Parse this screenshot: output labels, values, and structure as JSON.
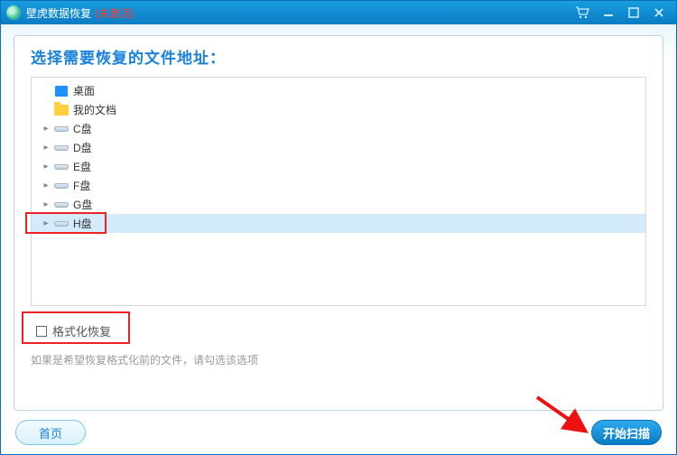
{
  "titlebar": {
    "app_name": "壁虎数据恢复",
    "activation_status": "(未激活)"
  },
  "panel": {
    "heading": "选择需要恢复的文件地址："
  },
  "tree": {
    "nodes": [
      {
        "label": "桌面",
        "icon": "desktop",
        "expandable": false,
        "selected": false
      },
      {
        "label": "我的文档",
        "icon": "docs",
        "expandable": false,
        "selected": false
      },
      {
        "label": "C盘",
        "icon": "drive",
        "expandable": true,
        "selected": false
      },
      {
        "label": "D盘",
        "icon": "drive",
        "expandable": true,
        "selected": false
      },
      {
        "label": "E盘",
        "icon": "drive",
        "expandable": true,
        "selected": false
      },
      {
        "label": "F盘",
        "icon": "drive",
        "expandable": true,
        "selected": false
      },
      {
        "label": "G盘",
        "icon": "drive",
        "expandable": true,
        "selected": false
      },
      {
        "label": "H盘",
        "icon": "drive",
        "expandable": true,
        "selected": true
      }
    ]
  },
  "options": {
    "format_restore_label": "格式化恢复",
    "format_restore_checked": false,
    "hint": "如果是希望恢复格式化前的文件，请勾选该选项"
  },
  "footer": {
    "home_label": "首页",
    "scan_label": "开始扫描"
  },
  "colors": {
    "accent": "#0a7cc4",
    "selected_row": "#d4ebfb",
    "annotation": "#e22"
  }
}
